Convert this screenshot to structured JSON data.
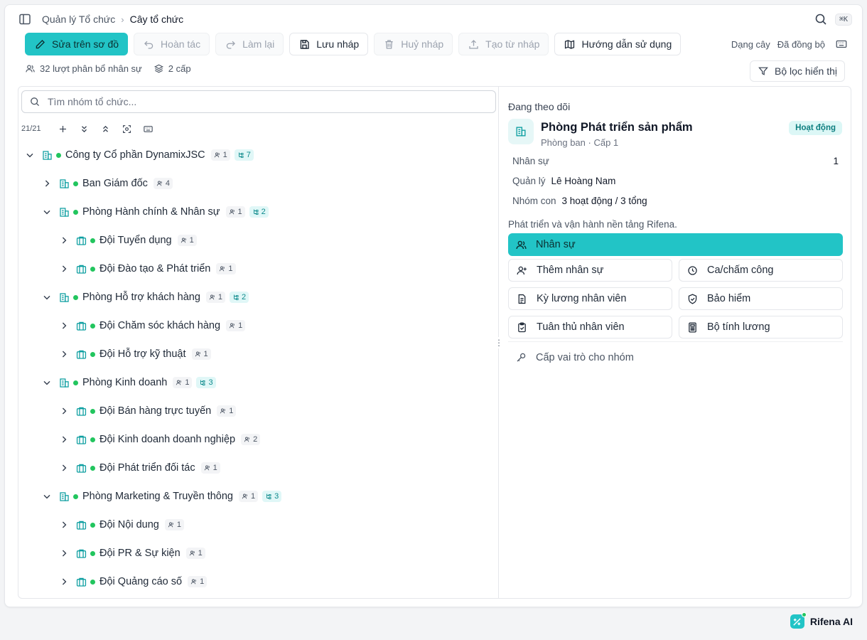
{
  "breadcrumb": {
    "parent": "Quản lý Tổ chức",
    "separator": "›",
    "current": "Cây tổ chức"
  },
  "shortcut": "⌘K",
  "toolbar": {
    "edit_on_chart": "Sửa trên sơ đồ",
    "undo": "Hoàn tác",
    "redo": "Làm lại",
    "save_draft": "Lưu nháp",
    "cancel_draft": "Huỷ nháp",
    "create_from_draft": "Tạo từ nháp",
    "guide": "Hướng dẫn sử dụng",
    "view_mode": "Dạng cây",
    "sync_status": "Đã đồng bộ"
  },
  "stats": {
    "assignments": "32 lượt phân bổ nhân sự",
    "levels": "2 cấp"
  },
  "filter_label": "Bộ lọc hiển thị",
  "search": {
    "placeholder": "Tìm nhóm tổ chức..."
  },
  "tree_count": "21/21",
  "tree": [
    {
      "name": "Công ty Cổ phần DynamixJSC",
      "members": "1",
      "children": "7",
      "expanded": true,
      "level": 0,
      "type": "company"
    },
    {
      "name": "Ban Giám đốc",
      "members": "4",
      "children": "",
      "expanded": false,
      "level": 1,
      "type": "department"
    },
    {
      "name": "Phòng Hành chính & Nhân sự",
      "members": "1",
      "children": "2",
      "expanded": true,
      "level": 1,
      "type": "department"
    },
    {
      "name": "Đội Tuyển dụng",
      "members": "1",
      "children": "",
      "expanded": false,
      "level": 2,
      "type": "team"
    },
    {
      "name": "Đội Đào tạo & Phát triển",
      "members": "1",
      "children": "",
      "expanded": false,
      "level": 2,
      "type": "team"
    },
    {
      "name": "Phòng Hỗ trợ khách hàng",
      "members": "1",
      "children": "2",
      "expanded": true,
      "level": 1,
      "type": "department"
    },
    {
      "name": "Đội Chăm sóc khách hàng",
      "members": "1",
      "children": "",
      "expanded": false,
      "level": 2,
      "type": "team"
    },
    {
      "name": "Đội Hỗ trợ kỹ thuật",
      "members": "1",
      "children": "",
      "expanded": false,
      "level": 2,
      "type": "team"
    },
    {
      "name": "Phòng Kinh doanh",
      "members": "1",
      "children": "3",
      "expanded": true,
      "level": 1,
      "type": "department"
    },
    {
      "name": "Đội Bán hàng trực tuyến",
      "members": "1",
      "children": "",
      "expanded": false,
      "level": 2,
      "type": "team"
    },
    {
      "name": "Đội Kinh doanh doanh nghiệp",
      "members": "2",
      "children": "",
      "expanded": false,
      "level": 2,
      "type": "team"
    },
    {
      "name": "Đội Phát triển đối tác",
      "members": "1",
      "children": "",
      "expanded": false,
      "level": 2,
      "type": "team"
    },
    {
      "name": "Phòng Marketing & Truyền thông",
      "members": "1",
      "children": "3",
      "expanded": true,
      "level": 1,
      "type": "department"
    },
    {
      "name": "Đội Nội dung",
      "members": "1",
      "children": "",
      "expanded": false,
      "level": 2,
      "type": "team"
    },
    {
      "name": "Đội PR & Sự kiện",
      "members": "1",
      "children": "",
      "expanded": false,
      "level": 2,
      "type": "team"
    },
    {
      "name": "Đội Quảng cáo số",
      "members": "1",
      "children": "",
      "expanded": false,
      "level": 2,
      "type": "team"
    }
  ],
  "detail": {
    "follow_label": "Đang theo dõi",
    "name": "Phòng Phát triển sản phẩm",
    "subtitle": "Phòng ban · Cấp 1",
    "status": "Hoạt động",
    "staff_label": "Nhân sự",
    "staff_value": "1",
    "manager_label": "Quản lý",
    "manager_value": "Lê Hoàng Nam",
    "subgroups_label": "Nhóm con",
    "subgroups_value": "3 hoạt động / 3 tổng",
    "description": "Phát triển và vận hành nền tảng Rifena.",
    "actions": {
      "staff": "Nhân sự",
      "add_staff": "Thêm nhân sự",
      "attendance": "Ca/chấm công",
      "payroll_period": "Kỳ lương nhân viên",
      "insurance": "Bảo hiểm",
      "compliance": "Tuân thủ nhân viên",
      "salary_calc": "Bộ tính lương",
      "assign_role": "Cấp vai trò cho nhóm"
    }
  },
  "ai": {
    "label": "Rifena AI"
  },
  "colors": {
    "accent": "#22c4c6",
    "icon_teal": "#0e9fa1",
    "status_green": "#22c55e"
  }
}
